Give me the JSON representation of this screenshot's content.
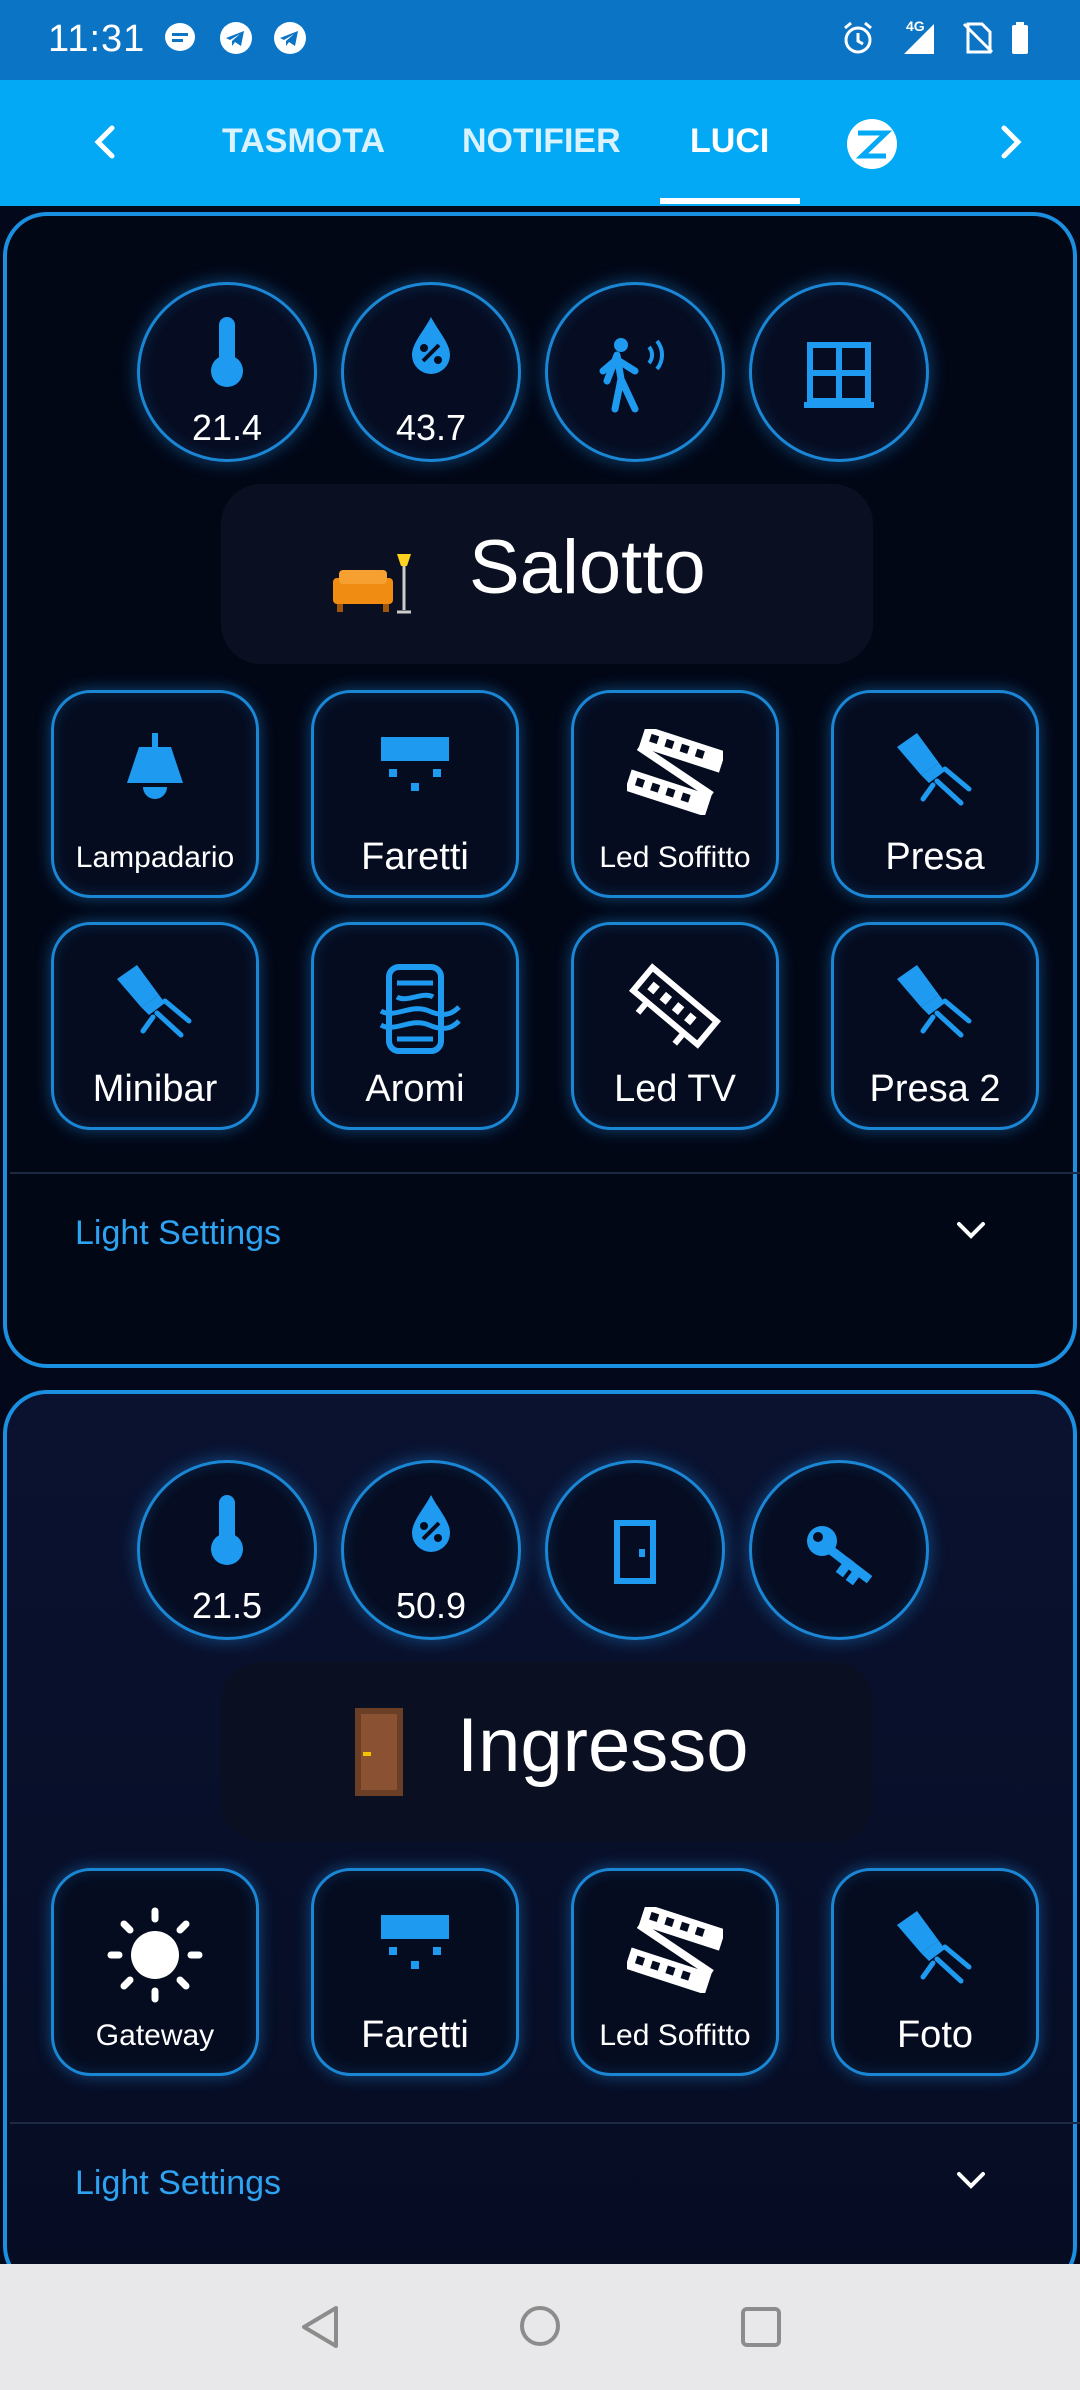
{
  "status_bar": {
    "time": "11:31",
    "network": "4G"
  },
  "tabs": {
    "items": [
      {
        "label": "TASMOTA"
      },
      {
        "label": "NOTIFIER"
      },
      {
        "label": "LUCI"
      }
    ],
    "active": "LUCI",
    "icons": [
      "chevron-left-icon",
      "zigbee-icon",
      "chevron-right-icon"
    ]
  },
  "rooms": [
    {
      "title": "Salotto",
      "emoji": "🛋️",
      "sensors": [
        {
          "icon": "thermometer-icon",
          "value": "21.4"
        },
        {
          "icon": "humidity-icon",
          "value": "43.7"
        },
        {
          "icon": "motion-icon",
          "value": ""
        },
        {
          "icon": "window-icon",
          "value": ""
        }
      ],
      "buttons": [
        {
          "label": "Lampadario",
          "icon": "ceiling-lamp-icon"
        },
        {
          "label": "Faretti",
          "icon": "spotlights-icon"
        },
        {
          "label": "Led Soffitto",
          "icon": "led-strip-icon"
        },
        {
          "label": "Presa",
          "icon": "plug-icon"
        },
        {
          "label": "Minibar",
          "icon": "plug-icon"
        },
        {
          "label": "Aromi",
          "icon": "aroma-diffuser-icon"
        },
        {
          "label": "Led TV",
          "icon": "led-strip-icon"
        },
        {
          "label": "Presa 2",
          "icon": "plug-icon"
        }
      ],
      "settings_label": "Light Settings"
    },
    {
      "title": "Ingresso",
      "emoji": "🚪",
      "sensors": [
        {
          "icon": "thermometer-icon",
          "value": "21.5"
        },
        {
          "icon": "humidity-icon",
          "value": "50.9"
        },
        {
          "icon": "door-icon",
          "value": ""
        },
        {
          "icon": "key-icon",
          "value": ""
        }
      ],
      "buttons": [
        {
          "label": "Gateway",
          "icon": "sun-icon"
        },
        {
          "label": "Faretti",
          "icon": "spotlights-icon"
        },
        {
          "label": "Led Soffitto",
          "icon": "led-strip-icon"
        },
        {
          "label": "Foto",
          "icon": "plug-icon"
        }
      ],
      "settings_label": "Light Settings"
    }
  ],
  "colors": {
    "accent": "#03a9f4",
    "icon_blue": "#1e9bf0",
    "card_border": "#1b8fe0"
  }
}
